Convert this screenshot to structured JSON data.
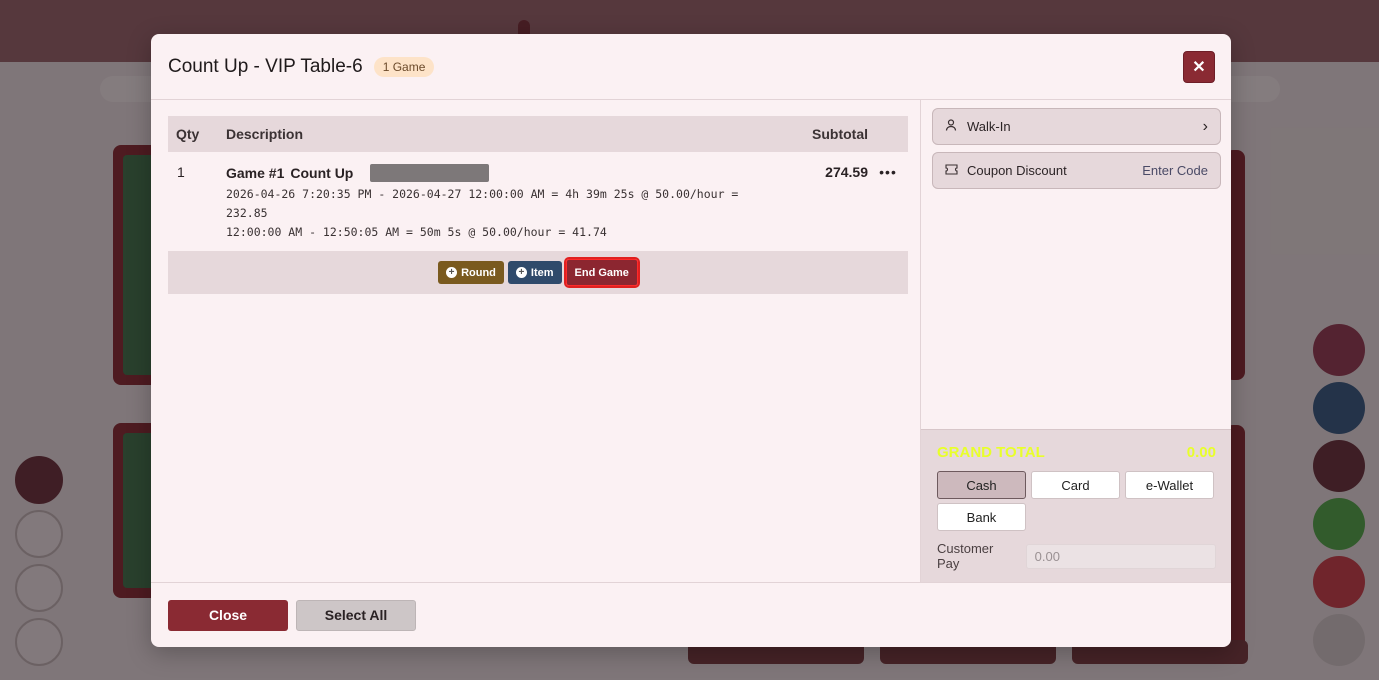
{
  "modal": {
    "title": "Count Up - VIP Table-6",
    "badge": "1 Game",
    "close_icon": "✕"
  },
  "table": {
    "headers": {
      "qty": "Qty",
      "description": "Description",
      "subtotal": "Subtotal"
    },
    "rows": [
      {
        "qty": "1",
        "game": "Game #1",
        "mode": "Count Up",
        "line1": "2026-04-26 7:20:35 PM - 2026-04-27 12:00:00 AM = 4h 39m 25s @ 50.00/hour =",
        "line2": "232.85",
        "line3": "12:00:00 AM - 12:50:05 AM = 50m 5s @ 50.00/hour = 41.74",
        "subtotal": "274.59",
        "menu": "•••"
      }
    ]
  },
  "actions": {
    "round": "Round",
    "item": "Item",
    "end_game": "End Game"
  },
  "sidebar": {
    "customer": "Walk-In",
    "coupon_label": "Coupon Discount",
    "coupon_action": "Enter Code"
  },
  "payment": {
    "grand_total_label": "GRAND TOTAL",
    "grand_total_value": "0.00",
    "methods": [
      "Cash",
      "Card",
      "e-Wallet",
      "Bank"
    ],
    "selected": "Cash",
    "customer_pay_label": "Customer Pay",
    "customer_pay_placeholder": "0.00"
  },
  "footer": {
    "close": "Close",
    "select_all": "Select All"
  },
  "colors": {
    "brand": "#8a2a33",
    "grand_total": "#e8ff2a",
    "highlight": "#e02020"
  }
}
